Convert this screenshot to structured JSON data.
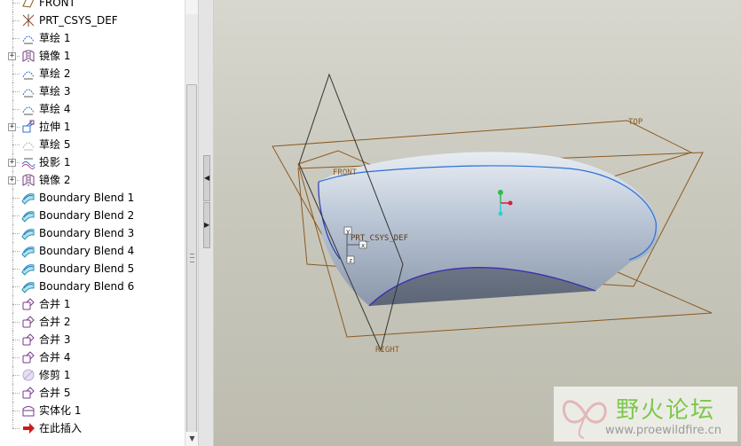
{
  "model_tree": {
    "items": [
      {
        "label": "FRONT",
        "icon": "datum-plane-icon",
        "expandable": false
      },
      {
        "label": "PRT_CSYS_DEF",
        "icon": "csys-icon",
        "expandable": false
      },
      {
        "label": "草绘 1",
        "icon": "sketch-icon",
        "expandable": false
      },
      {
        "label": "镜像 1",
        "icon": "mirror-icon",
        "expandable": true
      },
      {
        "label": "草绘 2",
        "icon": "sketch-icon",
        "expandable": false
      },
      {
        "label": "草绘 3",
        "icon": "sketch-icon",
        "expandable": false
      },
      {
        "label": "草绘 4",
        "icon": "sketch-icon",
        "expandable": false
      },
      {
        "label": "拉伸 1",
        "icon": "extrude-icon",
        "expandable": true
      },
      {
        "label": "草绘 5",
        "icon": "sketch-dim-icon",
        "expandable": false
      },
      {
        "label": "投影 1",
        "icon": "projection-icon",
        "expandable": true
      },
      {
        "label": "镜像 2",
        "icon": "mirror-icon",
        "expandable": true
      },
      {
        "label": "Boundary Blend 1",
        "icon": "boundary-blend-icon",
        "expandable": false
      },
      {
        "label": "Boundary Blend 2",
        "icon": "boundary-blend-icon",
        "expandable": false
      },
      {
        "label": "Boundary Blend 3",
        "icon": "boundary-blend-icon",
        "expandable": false
      },
      {
        "label": "Boundary Blend 4",
        "icon": "boundary-blend-icon",
        "expandable": false
      },
      {
        "label": "Boundary Blend 5",
        "icon": "boundary-blend-icon",
        "expandable": false
      },
      {
        "label": "Boundary Blend 6",
        "icon": "boundary-blend-icon",
        "expandable": false
      },
      {
        "label": "合并 1",
        "icon": "merge-icon",
        "expandable": false
      },
      {
        "label": "合并 2",
        "icon": "merge-icon",
        "expandable": false
      },
      {
        "label": "合并 3",
        "icon": "merge-icon",
        "expandable": false
      },
      {
        "label": "合并 4",
        "icon": "merge-icon",
        "expandable": false
      },
      {
        "label": "修剪 1",
        "icon": "trim-icon",
        "expandable": false
      },
      {
        "label": "合并 5",
        "icon": "merge-icon",
        "expandable": false
      },
      {
        "label": "实体化 1",
        "icon": "solidify-icon",
        "expandable": false
      },
      {
        "label": "在此插入",
        "icon": "insert-here-icon",
        "expandable": false
      }
    ]
  },
  "viewport": {
    "datum_labels": {
      "top": "TOP",
      "front": "FRONT",
      "right": "RIGHT",
      "csys": "PRT_CSYS_DEF"
    },
    "axis_labels": {
      "x": "x",
      "y": "y",
      "z": "z"
    }
  },
  "watermark": {
    "title": "野火论坛",
    "url": "www.proewildfire.cn"
  },
  "colors": {
    "datum_plane": "#8a5a20",
    "surface_edge": "#2a6fd6",
    "surface_fill": "#b8c4d4",
    "viewport_bg": "#c9c8bd",
    "watermark_green": "#7cc84a"
  }
}
